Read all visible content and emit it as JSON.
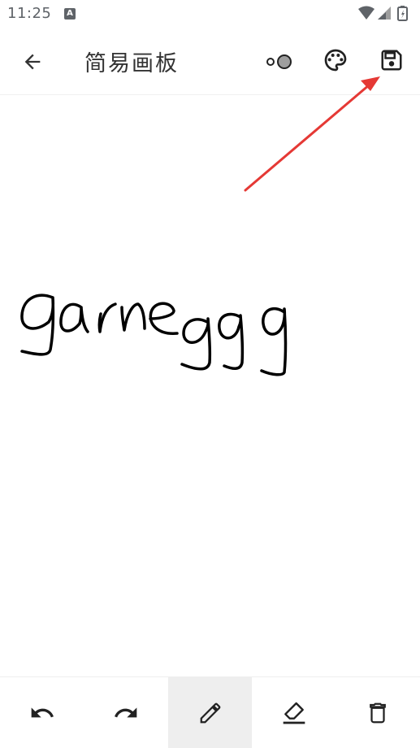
{
  "status_bar": {
    "time": "11:25",
    "notification_icon": "text-a-icon",
    "icons": [
      "wifi-icon",
      "signal-icon",
      "battery-icon"
    ]
  },
  "app_bar": {
    "title": "简易画板",
    "back_icon": "arrow-back-icon",
    "actions": [
      {
        "name": "brush-size-icon"
      },
      {
        "name": "palette-icon"
      },
      {
        "name": "save-icon"
      }
    ]
  },
  "canvas": {
    "drawing_text": "gameggg",
    "stroke_color": "#000000"
  },
  "annotation": {
    "arrow_color": "#e53935",
    "points_to": "save-icon"
  },
  "toolbar": {
    "tools": [
      {
        "name": "undo-icon",
        "active": false
      },
      {
        "name": "redo-icon",
        "active": false
      },
      {
        "name": "pen-icon",
        "active": true
      },
      {
        "name": "eraser-icon",
        "active": false
      },
      {
        "name": "delete-icon",
        "active": false
      }
    ]
  }
}
